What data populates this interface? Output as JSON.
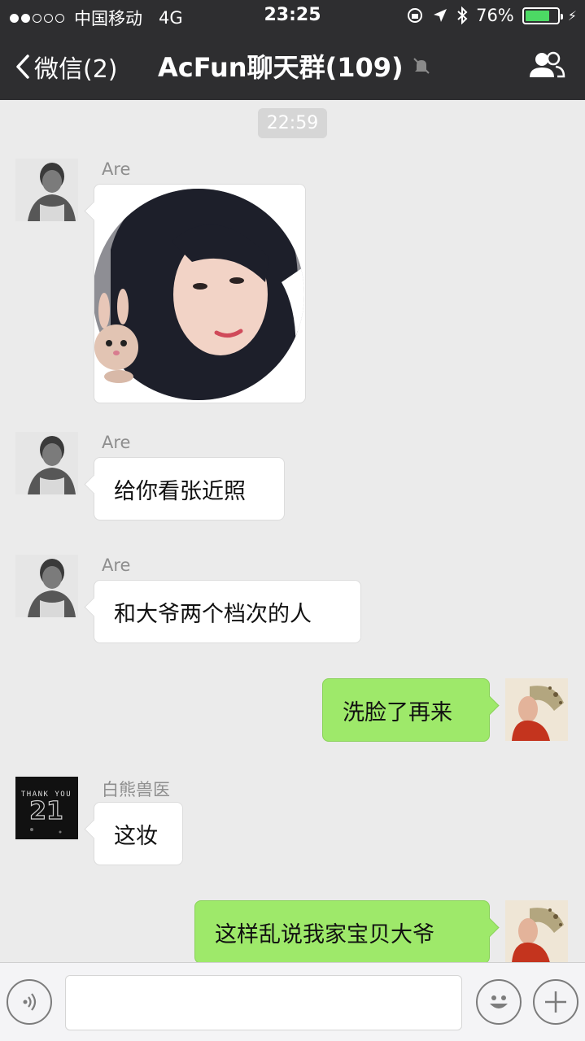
{
  "status_bar": {
    "carrier": "中国移动",
    "network": "4G",
    "time": "23:25",
    "battery": "76%",
    "battery_level": 0.76
  },
  "nav": {
    "back_label": "微信(2)",
    "title": "AcFun聊天群(109)",
    "icons": [
      "chevron-left-icon",
      "mute-bell-icon",
      "group-members-icon"
    ]
  },
  "chat": {
    "timestamp": "22:59",
    "messages": [
      {
        "side": "in",
        "sender": "Are",
        "type": "image"
      },
      {
        "side": "in",
        "sender": "Are",
        "text": "给你看张近照"
      },
      {
        "side": "in",
        "sender": "Are",
        "text": "和大爷两个档次的人"
      },
      {
        "side": "out",
        "text": "洗脸了再来"
      },
      {
        "side": "in",
        "sender": "白熊兽医",
        "text": "这妆"
      },
      {
        "side": "out",
        "text": "这样乱说我家宝贝大爷"
      }
    ]
  },
  "avatar_badge": {
    "text": "THANK YOU",
    "number": "21"
  },
  "input_bar": {
    "icons": [
      "voice-icon",
      "emoji-icon",
      "plus-icon"
    ]
  },
  "colors": {
    "nav_bg": "#2e2e30",
    "chat_bg": "#ebebeb",
    "outgoing_bubble": "#9ee96a",
    "incoming_bubble": "#ffffff"
  }
}
